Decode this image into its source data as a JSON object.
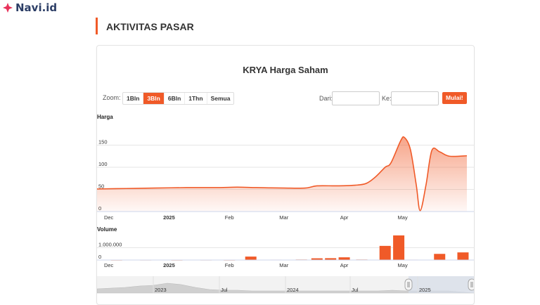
{
  "brand": {
    "name": "Navi.id",
    "icon": "diamond-logo-icon",
    "color": "#e8325a"
  },
  "section": {
    "title": "AKTIVITAS PASAR",
    "accent": "#f05a28"
  },
  "chart": {
    "title": "KRYA Harga Saham",
    "zoom_label": "Zoom:",
    "zoom_options": [
      "1Bln",
      "3Bln",
      "6Bln",
      "1Thn",
      "Semua"
    ],
    "zoom_selected": "3Bln",
    "from_label": "Dari:",
    "to_label": "Ke:",
    "from_value": "",
    "to_value": "",
    "go_label": "Mulai!",
    "price_axis_title": "Harga",
    "volume_axis_title": "Volume",
    "navigator_labels": [
      "2023",
      "Jul",
      "2024",
      "Jul",
      "2025"
    ]
  },
  "chart_data": [
    {
      "type": "area",
      "title": "KRYA Harga Saham",
      "ylabel": "Harga",
      "ylim": [
        0,
        200
      ],
      "y_ticks": [
        0,
        50,
        100,
        150
      ],
      "x_ticks": [
        "Dec",
        "2025",
        "Feb",
        "Mar",
        "Apr",
        "May"
      ],
      "color": "#f05a28",
      "points": [
        {
          "x": "2024-11-25",
          "y": 51
        },
        {
          "x": "2024-12-10",
          "y": 52
        },
        {
          "x": "2024-12-25",
          "y": 53
        },
        {
          "x": "2025-01-10",
          "y": 54
        },
        {
          "x": "2025-01-25",
          "y": 54
        },
        {
          "x": "2025-02-05",
          "y": 55
        },
        {
          "x": "2025-02-15",
          "y": 54
        },
        {
          "x": "2025-03-01",
          "y": 53
        },
        {
          "x": "2025-03-12",
          "y": 53
        },
        {
          "x": "2025-03-18",
          "y": 58
        },
        {
          "x": "2025-03-28",
          "y": 58
        },
        {
          "x": "2025-04-05",
          "y": 59
        },
        {
          "x": "2025-04-12",
          "y": 63
        },
        {
          "x": "2025-04-17",
          "y": 78
        },
        {
          "x": "2025-04-22",
          "y": 100
        },
        {
          "x": "2025-04-25",
          "y": 110
        },
        {
          "x": "2025-04-30",
          "y": 160
        },
        {
          "x": "2025-05-02",
          "y": 167
        },
        {
          "x": "2025-05-05",
          "y": 140
        },
        {
          "x": "2025-05-08",
          "y": 60
        },
        {
          "x": "2025-05-10",
          "y": 2
        },
        {
          "x": "2025-05-13",
          "y": 60
        },
        {
          "x": "2025-05-16",
          "y": 138
        },
        {
          "x": "2025-05-20",
          "y": 135
        },
        {
          "x": "2025-05-25",
          "y": 125
        },
        {
          "x": "2025-06-03",
          "y": 126
        }
      ]
    },
    {
      "type": "bar",
      "title": "",
      "ylabel": "Volume",
      "ylim": [
        0,
        2000000
      ],
      "y_ticks": [
        0,
        1000000
      ],
      "y_tick_labels": [
        "0",
        "1.000.000"
      ],
      "x_ticks": [
        "Dec",
        "2025",
        "Feb",
        "Mar",
        "Apr",
        "May"
      ],
      "color": "#f05a28",
      "bars": [
        {
          "x": "2024-12-05",
          "y": 20000
        },
        {
          "x": "2024-12-20",
          "y": 25000
        },
        {
          "x": "2025-01-05",
          "y": 20000
        },
        {
          "x": "2025-01-20",
          "y": 25000
        },
        {
          "x": "2025-02-01",
          "y": 20000
        },
        {
          "x": "2025-02-12",
          "y": 280000
        },
        {
          "x": "2025-02-25",
          "y": 30000
        },
        {
          "x": "2025-03-10",
          "y": 40000
        },
        {
          "x": "2025-03-18",
          "y": 140000
        },
        {
          "x": "2025-03-25",
          "y": 150000
        },
        {
          "x": "2025-04-01",
          "y": 220000
        },
        {
          "x": "2025-04-10",
          "y": 40000
        },
        {
          "x": "2025-04-22",
          "y": 1150000
        },
        {
          "x": "2025-04-29",
          "y": 2100000
        },
        {
          "x": "2025-05-06",
          "y": 30000
        },
        {
          "x": "2025-05-20",
          "y": 500000
        },
        {
          "x": "2025-06-01",
          "y": 620000
        }
      ]
    }
  ]
}
